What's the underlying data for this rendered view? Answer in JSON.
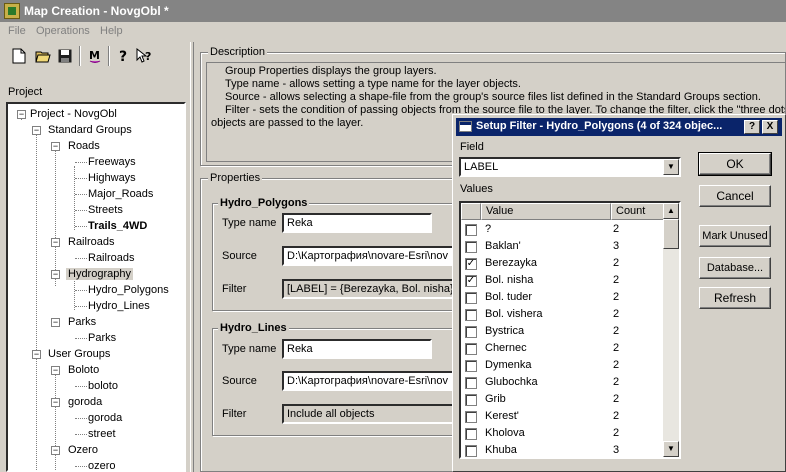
{
  "window": {
    "title": "Map Creation - NovgObl *"
  },
  "menu": {
    "items": [
      "File",
      "Operations",
      "Help"
    ]
  },
  "toolbar": {
    "buttons": [
      "new-file-icon",
      "open-folder-icon",
      "save-icon",
      "map-icon",
      "help-icon",
      "context-help-icon"
    ]
  },
  "project": {
    "label": "Project",
    "tree": {
      "root": "Project - NovgObl",
      "standard_groups": "Standard Groups",
      "roads": "Roads",
      "freeways": "Freeways",
      "highways": "Highways",
      "major_roads": "Major_Roads",
      "streets": "Streets",
      "trails": "Trails_4WD",
      "railroads": "Railroads",
      "railroads_layer": "Railroads",
      "hydrography": "Hydrography",
      "hydro_polygons": "Hydro_Polygons",
      "hydro_lines": "Hydro_Lines",
      "parks": "Parks",
      "parks_layer": "Parks",
      "user_groups": "User Groups",
      "boloto": "Boloto",
      "boloto_layer": "boloto",
      "goroda": "goroda",
      "goroda_layer": "goroda",
      "street": "street",
      "ozero": "Ozero",
      "ozero_layer": "ozero"
    }
  },
  "description": {
    "label": "Description",
    "lines": [
      "Group Properties displays the group layers.",
      "Type name - allows setting a type name for the layer objects.",
      "Source - allows selecting a shape-file from the group's source files list defined in the Standard Groups section.",
      "Filter - sets the condition of passing objects from the source file to the layer. To change the filter, click the \"three dots\" bu",
      "objects are passed to the layer."
    ]
  },
  "properties": {
    "label": "Properties",
    "groups": [
      {
        "title": "Hydro_Polygons",
        "type_name_label": "Type name",
        "type_name": "Reka",
        "source_label": "Source",
        "source": "D:\\Картография\\novare-Esri\\nov",
        "filter_label": "Filter",
        "filter": "[LABEL] = {Berezayka, Bol. nisha}"
      },
      {
        "title": "Hydro_Lines",
        "type_name_label": "Type name",
        "type_name": "Reka",
        "source_label": "Source",
        "source": "D:\\Картография\\novare-Esri\\nov",
        "filter_label": "Filter",
        "filter": "Include all objects"
      }
    ]
  },
  "dialog": {
    "title": "Setup Filter - Hydro_Polygons (4 of 324 objec...",
    "help_btn": "?",
    "close_btn": "X",
    "field_label": "Field",
    "field_value": "LABEL",
    "values_label": "Values",
    "col_value": "Value",
    "col_count": "Count",
    "rows": [
      {
        "value": "?",
        "count": "2",
        "checked": false
      },
      {
        "value": "Baklan'",
        "count": "3",
        "checked": false
      },
      {
        "value": "Berezayka",
        "count": "2",
        "checked": true
      },
      {
        "value": "Bol. nisha",
        "count": "2",
        "checked": true
      },
      {
        "value": "Bol. tuder",
        "count": "2",
        "checked": false
      },
      {
        "value": "Bol. vishera",
        "count": "2",
        "checked": false
      },
      {
        "value": "Bystrica",
        "count": "2",
        "checked": false
      },
      {
        "value": "Chernec",
        "count": "2",
        "checked": false
      },
      {
        "value": "Dymenka",
        "count": "2",
        "checked": false
      },
      {
        "value": "Glubochka",
        "count": "2",
        "checked": false
      },
      {
        "value": "Grib",
        "count": "2",
        "checked": false
      },
      {
        "value": "Kerest'",
        "count": "2",
        "checked": false
      },
      {
        "value": "Kholova",
        "count": "2",
        "checked": false
      },
      {
        "value": "Khuba",
        "count": "3",
        "checked": false
      }
    ],
    "ok": "OK",
    "cancel": "Cancel",
    "mark_unused": "Mark Unused",
    "database": "Database...",
    "refresh": "Refresh"
  }
}
